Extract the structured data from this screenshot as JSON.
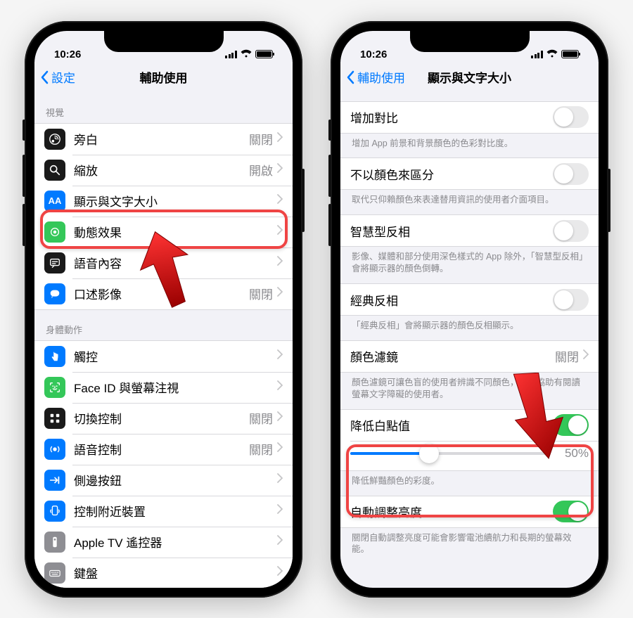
{
  "status": {
    "time": "10:26"
  },
  "left": {
    "back": "設定",
    "title": "輔助使用",
    "group1_header": "視覺",
    "rows1": {
      "voiceover": {
        "label": "旁白",
        "value": "關閉"
      },
      "zoom": {
        "label": "縮放",
        "value": "開啟"
      },
      "display": {
        "label": "顯示與文字大小"
      },
      "motion": {
        "label": "動態效果"
      },
      "spoken": {
        "label": "語音內容"
      },
      "audiodesc": {
        "label": "口述影像",
        "value": "關閉"
      }
    },
    "group2_header": "身體動作",
    "rows2": {
      "touch": {
        "label": "觸控"
      },
      "faceid": {
        "label": "Face ID 與螢幕注視"
      },
      "switch": {
        "label": "切換控制",
        "value": "關閉"
      },
      "voice": {
        "label": "語音控制",
        "value": "關閉"
      },
      "sidebtn": {
        "label": "側邊按鈕"
      },
      "nearby": {
        "label": "控制附近裝置"
      },
      "appletv": {
        "label": "Apple TV 遙控器"
      },
      "keyboard": {
        "label": "鍵盤"
      }
    }
  },
  "right": {
    "back": "輔助使用",
    "title": "顯示與文字大小",
    "rows": {
      "contrast": {
        "label": "增加對比",
        "foot": "增加 App 前景和背景顏色的色彩對比度。"
      },
      "diffcolor": {
        "label": "不以顏色來區分",
        "foot": "取代只仰賴顏色來表達替用資訊的使用者介面項目。"
      },
      "smartinv": {
        "label": "智慧型反相",
        "foot": "影像、媒體和部分使用深色樣式的 App 除外，「智慧型反相」會將顯示器的顏色倒轉。"
      },
      "classicinv": {
        "label": "經典反相",
        "foot": "「經典反相」會將顯示器的顏色反相顯示。"
      },
      "filters": {
        "label": "顏色濾鏡",
        "value": "關閉",
        "foot": "顏色濾鏡可讓色盲的使用者辨識不同顏色，以及協助有閱讀螢幕文字障礙的使用者。"
      },
      "whitepoint": {
        "label": "降低白點值",
        "slider_value": "50%",
        "foot": "降低鮮豔顏色的彩度。"
      },
      "autobright": {
        "label": "自動調整亮度",
        "foot": "關閉自動調整亮度可能會影響電池續航力和長期的螢幕效能。"
      }
    }
  }
}
